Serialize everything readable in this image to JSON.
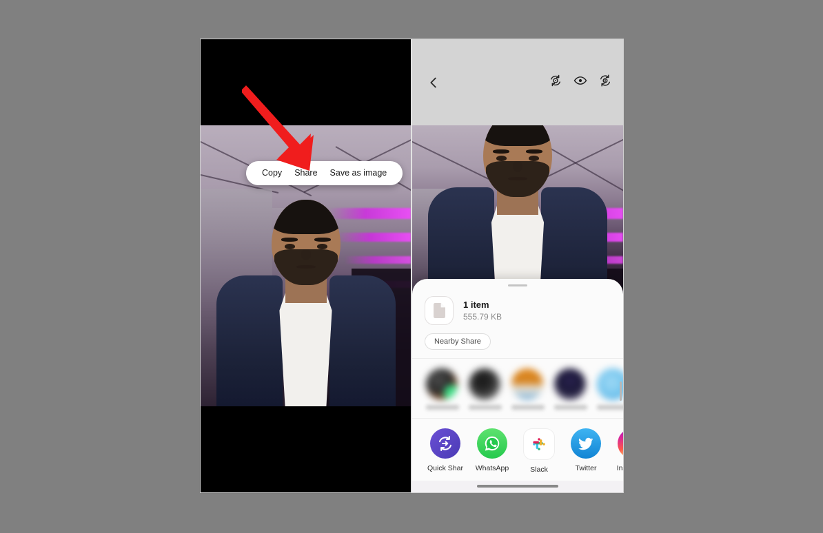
{
  "background_color": "#808080",
  "left_panel": {
    "name": "video-call-screenshot-with-context-menu",
    "letterbox_color": "#000000",
    "context_menu": {
      "items": [
        {
          "label": "Copy",
          "name": "copy"
        },
        {
          "label": "Share",
          "name": "share"
        },
        {
          "label": "Save as image",
          "name": "save-as-image"
        }
      ]
    },
    "annotation": {
      "type": "arrow",
      "color": "#f01d1d",
      "points_to": "Share"
    }
  },
  "right_panel": {
    "name": "android-share-sheet",
    "toolbar": {
      "background": "#d4d4d4",
      "back_label": "Back",
      "icons": [
        {
          "name": "rotate-play-icon"
        },
        {
          "name": "eye-icon"
        },
        {
          "name": "refresh-circle-icon"
        }
      ]
    },
    "share_sheet": {
      "file": {
        "title": "1 item",
        "size": "555.79 KB",
        "thumb_icon": "document-icon"
      },
      "chips": [
        {
          "label": "Nearby Share",
          "name": "nearby-share"
        }
      ],
      "contacts": [
        {
          "name": "contact-1",
          "blurred": true
        },
        {
          "name": "contact-2",
          "blurred": true
        },
        {
          "name": "contact-3",
          "blurred": true
        },
        {
          "name": "contact-4",
          "blurred": true
        },
        {
          "name": "contact-5",
          "blurred": true
        }
      ],
      "apps": [
        {
          "label": "Quick Share",
          "name": "quick-share",
          "color": "#5b4bc4"
        },
        {
          "label": "WhatsApp",
          "name": "whatsapp",
          "color": "#25d366"
        },
        {
          "label": "Slack",
          "name": "slack",
          "color": "#ffffff"
        },
        {
          "label": "Twitter",
          "name": "twitter",
          "color": "#1d9bf0"
        },
        {
          "label": "Instagram",
          "name": "instagram",
          "color": "#e1306c"
        }
      ],
      "gesture_bar": true
    }
  }
}
